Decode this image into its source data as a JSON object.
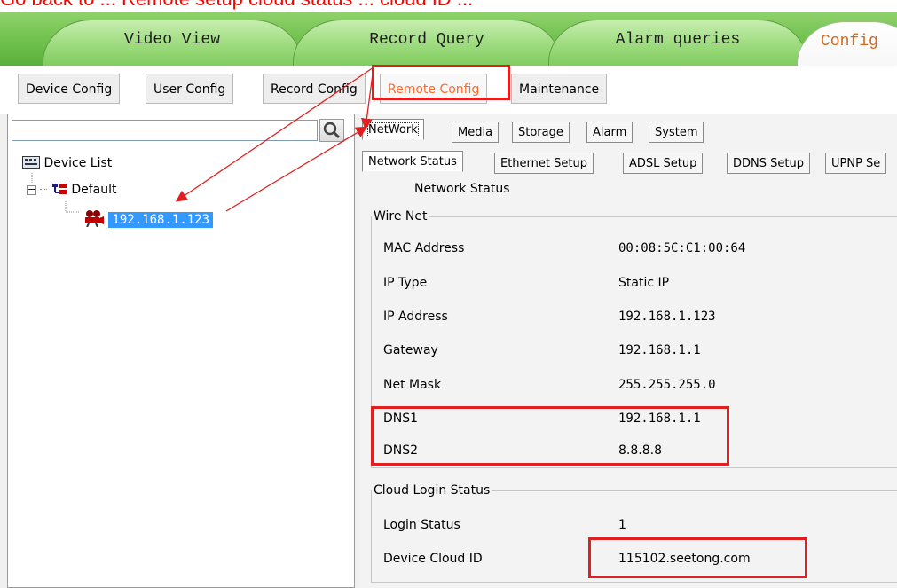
{
  "header_crop": {
    "text": "Go back to ... Remote setup cloud status ... cloud ID ..."
  },
  "main_tabs": [
    {
      "label": "Video View"
    },
    {
      "label": "Record Query"
    },
    {
      "label": "Alarm queries"
    },
    {
      "label": "Config"
    }
  ],
  "sub_menu": [
    {
      "label": "Device Config"
    },
    {
      "label": "User Config"
    },
    {
      "label": "Record Config"
    },
    {
      "label": "Remote Config"
    },
    {
      "label": "Maintenance"
    }
  ],
  "search": {
    "placeholder": ""
  },
  "tree": {
    "root": "Device List",
    "group": "Default",
    "device": "192.168.1.123"
  },
  "remote_tabs": [
    {
      "label": "NetWork"
    },
    {
      "label": "Media"
    },
    {
      "label": "Storage"
    },
    {
      "label": "Alarm"
    },
    {
      "label": "System"
    }
  ],
  "network_tabs": [
    {
      "label": "Network Status"
    },
    {
      "label": "Ethernet Setup"
    },
    {
      "label": "ADSL Setup"
    },
    {
      "label": "DDNS Setup"
    },
    {
      "label": "UPNP Se"
    }
  ],
  "network_status_title": "Network Status",
  "wire_net": {
    "legend": "Wire Net",
    "rows": [
      {
        "label": "MAC Address",
        "value": "00:08:5C:C1:00:64"
      },
      {
        "label": "IP Type",
        "value": "Static IP"
      },
      {
        "label": "IP Address",
        "value": "192.168.1.123"
      },
      {
        "label": "Gateway",
        "value": "192.168.1.1"
      },
      {
        "label": "Net Mask",
        "value": "255.255.255.0"
      },
      {
        "label": "DNS1",
        "value": "192.168.1.1"
      },
      {
        "label": "DNS2",
        "value": "8.8.8.8"
      }
    ]
  },
  "cloud": {
    "legend": "Cloud Login Status",
    "rows": [
      {
        "label": "Login Status",
        "value": "1"
      },
      {
        "label": "Device Cloud ID",
        "value": "115102.seetong.com"
      }
    ]
  },
  "icons": {
    "search": "search-icon",
    "device_list": "device-list-icon",
    "group": "group-node-icon",
    "camera": "camera-icon"
  },
  "colors": {
    "highlight": "#e02020",
    "selection": "#3399ff",
    "active_sub": "#ff6a2b",
    "tab_green": "#7fcb5d"
  }
}
